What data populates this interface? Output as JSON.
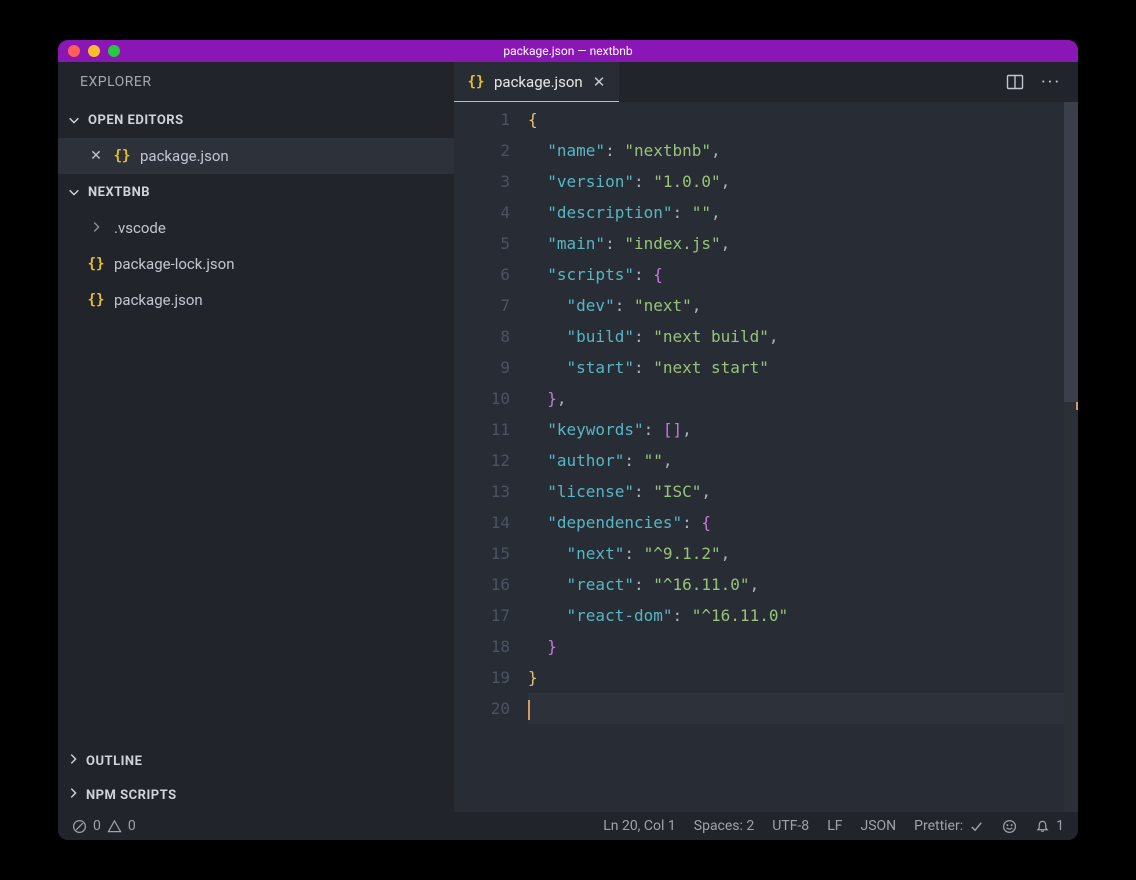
{
  "window": {
    "title": "package.json — nextbnb"
  },
  "sidebar": {
    "header": "EXPLORER",
    "sections": {
      "open_editors": "OPEN EDITORS",
      "project": "NEXTBNB",
      "outline": "OUTLINE",
      "npm_scripts": "NPM SCRIPTS"
    },
    "open_editor_items": [
      {
        "label": "package.json",
        "icon": "json"
      }
    ],
    "project_items": [
      {
        "label": ".vscode",
        "type": "folder"
      },
      {
        "label": "package-lock.json",
        "type": "json"
      },
      {
        "label": "package.json",
        "type": "json"
      }
    ]
  },
  "tabs": [
    {
      "label": "package.json",
      "icon": "json",
      "active": true
    }
  ],
  "editor": {
    "line_numbers": [
      "1",
      "2",
      "3",
      "4",
      "5",
      "6",
      "7",
      "8",
      "9",
      "10",
      "11",
      "12",
      "13",
      "14",
      "15",
      "16",
      "17",
      "18",
      "19",
      "20"
    ],
    "package_json": {
      "name": "nextbnb",
      "version": "1.0.0",
      "description": "",
      "main": "index.js",
      "scripts": {
        "dev": "next",
        "build": "next build",
        "start": "next start"
      },
      "keywords": [],
      "author": "",
      "license": "ISC",
      "dependencies": {
        "next": "^9.1.2",
        "react": "^16.11.0",
        "react-dom": "^16.11.0"
      }
    }
  },
  "statusbar": {
    "errors": "0",
    "warnings": "0",
    "cursor": "Ln 20, Col 1",
    "spaces": "Spaces: 2",
    "encoding": "UTF-8",
    "eol": "LF",
    "language": "JSON",
    "prettier": "Prettier:",
    "notifications": "1"
  }
}
